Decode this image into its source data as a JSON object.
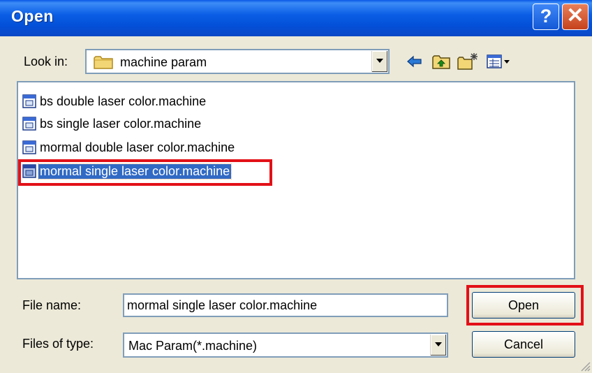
{
  "window": {
    "title": "Open",
    "help_label": "?",
    "close_label": "✕"
  },
  "look_in": {
    "label": "Look in:",
    "folder": "machine param"
  },
  "toolbar": {
    "icons": [
      "back-arrow-icon",
      "up-folder-icon",
      "new-folder-icon",
      "view-menu-icon"
    ]
  },
  "files": [
    {
      "name": "bs double laser color.machine",
      "selected": false
    },
    {
      "name": "bs single laser color.machine",
      "selected": false
    },
    {
      "name": "mormal double laser color.machine",
      "selected": false
    },
    {
      "name": "mormal single laser color.machine",
      "selected": true
    }
  ],
  "file_name": {
    "label": "File name:",
    "value": "mormal single laser color.machine"
  },
  "file_type": {
    "label": "Files of type:",
    "value": "Mac Param(*.machine)"
  },
  "buttons": {
    "open": "Open",
    "cancel": "Cancel"
  },
  "colors": {
    "titlebar": "#0a58e6",
    "dialog_bg": "#ece9d8",
    "selection": "#316ac5",
    "highlight_frame": "#e31017"
  }
}
